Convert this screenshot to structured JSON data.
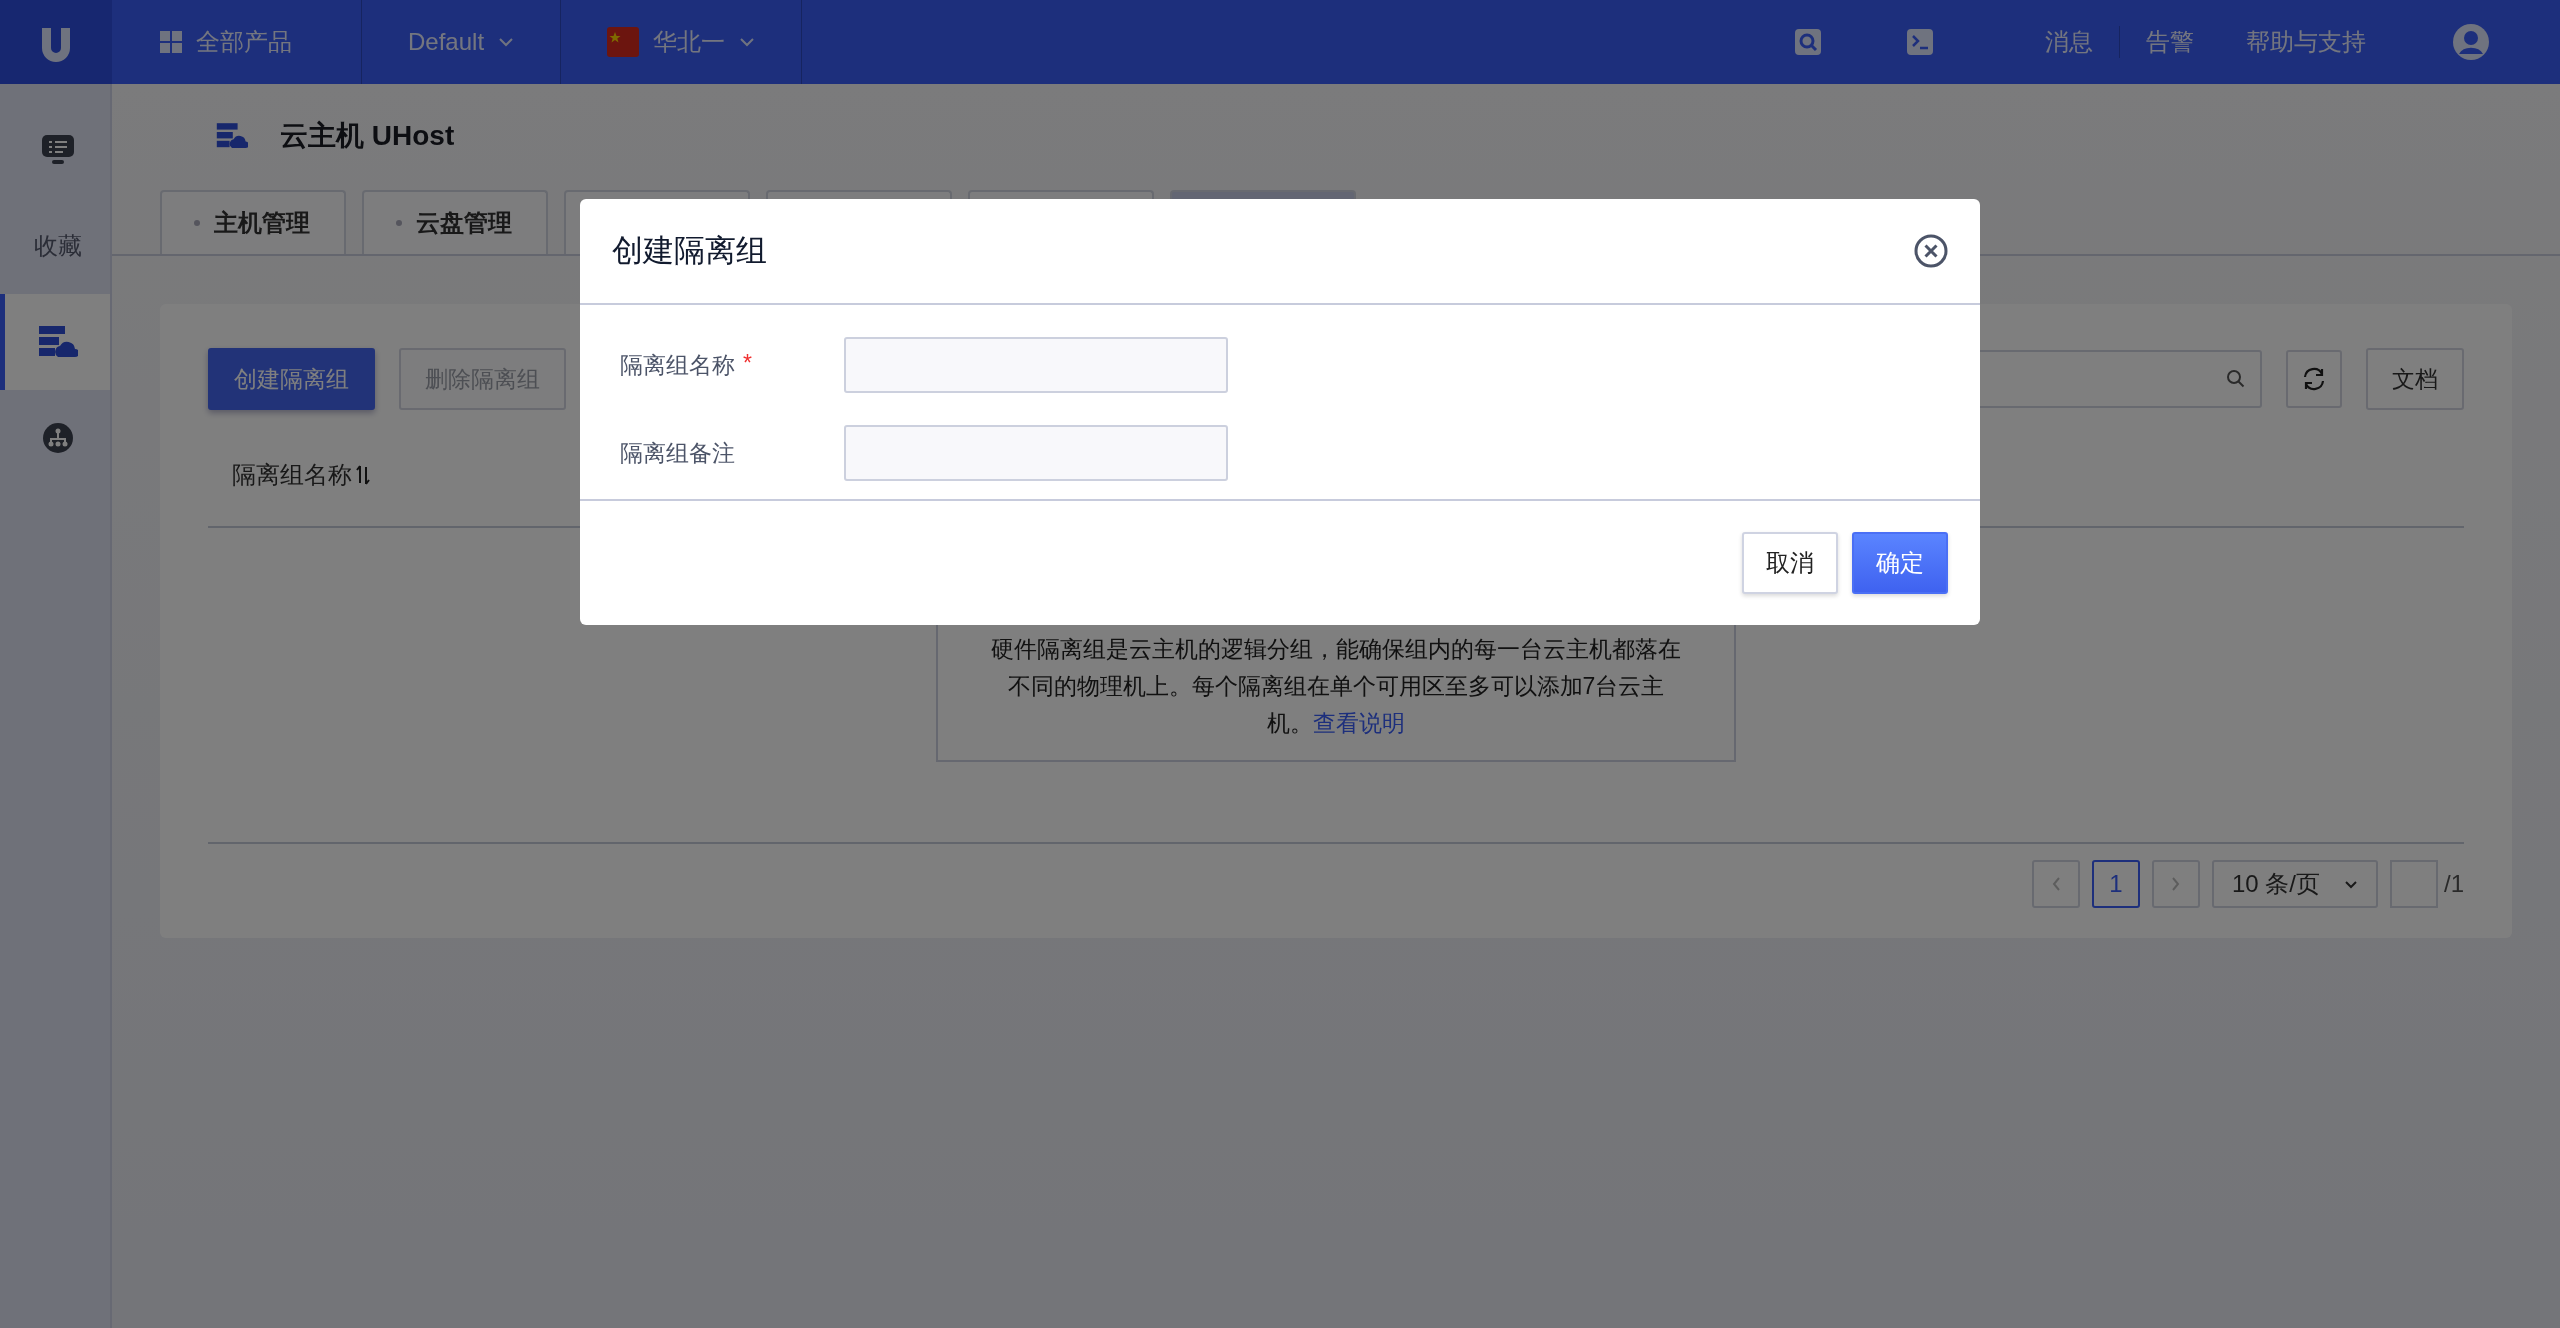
{
  "top_bar": {
    "products": "全部产品",
    "project": "Default",
    "region": "华北一",
    "links": [
      "消息",
      "告警",
      "帮助与支持"
    ]
  },
  "sidebar": {
    "items": [
      {
        "kind": "monitor",
        "selected": false
      },
      {
        "kind": "text",
        "label": "收藏",
        "selected": false
      },
      {
        "kind": "server",
        "selected": true
      },
      {
        "kind": "network",
        "selected": false
      }
    ]
  },
  "page": {
    "title": "云主机 UHost",
    "tabs": [
      {
        "label": "主机管理",
        "selected": false
      },
      {
        "label": "云盘管理",
        "selected": false
      },
      {
        "selected": false
      },
      {
        "selected": false
      },
      {
        "selected": false
      },
      {
        "selected": true
      }
    ]
  },
  "toolbar": {
    "buttons": [
      {
        "label": "创建隔离组",
        "kind": "primary",
        "disabled": false
      },
      {
        "label": "删除隔离组",
        "kind": "default",
        "disabled": true
      }
    ],
    "doc_button": "文档"
  },
  "table": {
    "columns": [
      "隔离组名称"
    ],
    "empty_text": "硬件隔离组是云主机的逻辑分组，能确保组内的每一台云主机都落在不同的物理机上。每个隔离组在单个可用区至多可以添加7台云主机。",
    "empty_link": "查看说明"
  },
  "pagination": {
    "pages": [
      {
        "label": "1",
        "selected": true
      }
    ],
    "page_size": "10 条/页",
    "total": "/1"
  },
  "dialog": {
    "title": "创建隔离组",
    "fields": [
      {
        "label": "隔离组名称",
        "required_mark": "*"
      },
      {
        "label": "隔离组备注"
      }
    ],
    "buttons": [
      {
        "label": "取消",
        "kind": "default"
      },
      {
        "label": "确定",
        "kind": "primary"
      }
    ]
  }
}
